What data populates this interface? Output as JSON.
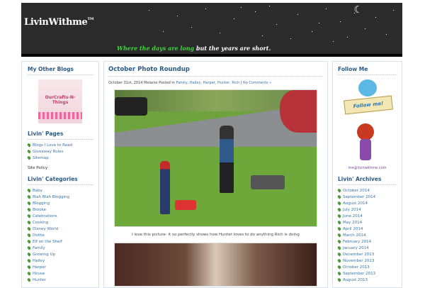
{
  "header": {
    "logo": "LivinWithme",
    "logo_tm": "TM",
    "tagline_part1": "Where the days are long",
    "tagline_part2": " but the years are short."
  },
  "left_sidebar": {
    "my_other_blogs_title": "My Other Blogs",
    "blog_thumb_text": "OurCrafts-N-Things",
    "livin_pages_title": "Livin' Pages",
    "pages": [
      "Blogs I Love to Read",
      "Giveaway Rules",
      "Sitemap"
    ],
    "site_policy": "Site Policy",
    "categories_title": "Livin' Categories",
    "categories": [
      "Baby",
      "Blah Blah Blogging",
      "Blogging",
      "Brooke",
      "Celebrations",
      "Cooking",
      "Disney World",
      "Dottie",
      "Elf on the Shelf",
      "Family",
      "Growing Up",
      "Hailey",
      "Harper",
      "House",
      "Hunter"
    ]
  },
  "post": {
    "title": "October Photo Roundup",
    "meta_date": "October 31st, 2014",
    "meta_author": "Melanie",
    "meta_posted_in": "Posted in",
    "meta_categories": "Family, Hailey, Harper, Hunter, Rich",
    "meta_sep": "|",
    "meta_comments": "No Comments »",
    "caption": "I love this picture- it so perfectly shows how Hunter loves to do anything Rich is doing"
  },
  "right_sidebar": {
    "follow_title": "Follow Me",
    "follow_badge": "Follow me!",
    "email": "me@livinwithme.com",
    "archives_title": "Livin' Archives",
    "archives": [
      "October 2014",
      "September 2014",
      "August 2014",
      "July 2014",
      "June 2014",
      "May 2014",
      "April 2014",
      "March 2014",
      "February 2014",
      "January 2014",
      "December 2013",
      "November 2013",
      "October 2013",
      "September 2013",
      "August 2013"
    ]
  }
}
